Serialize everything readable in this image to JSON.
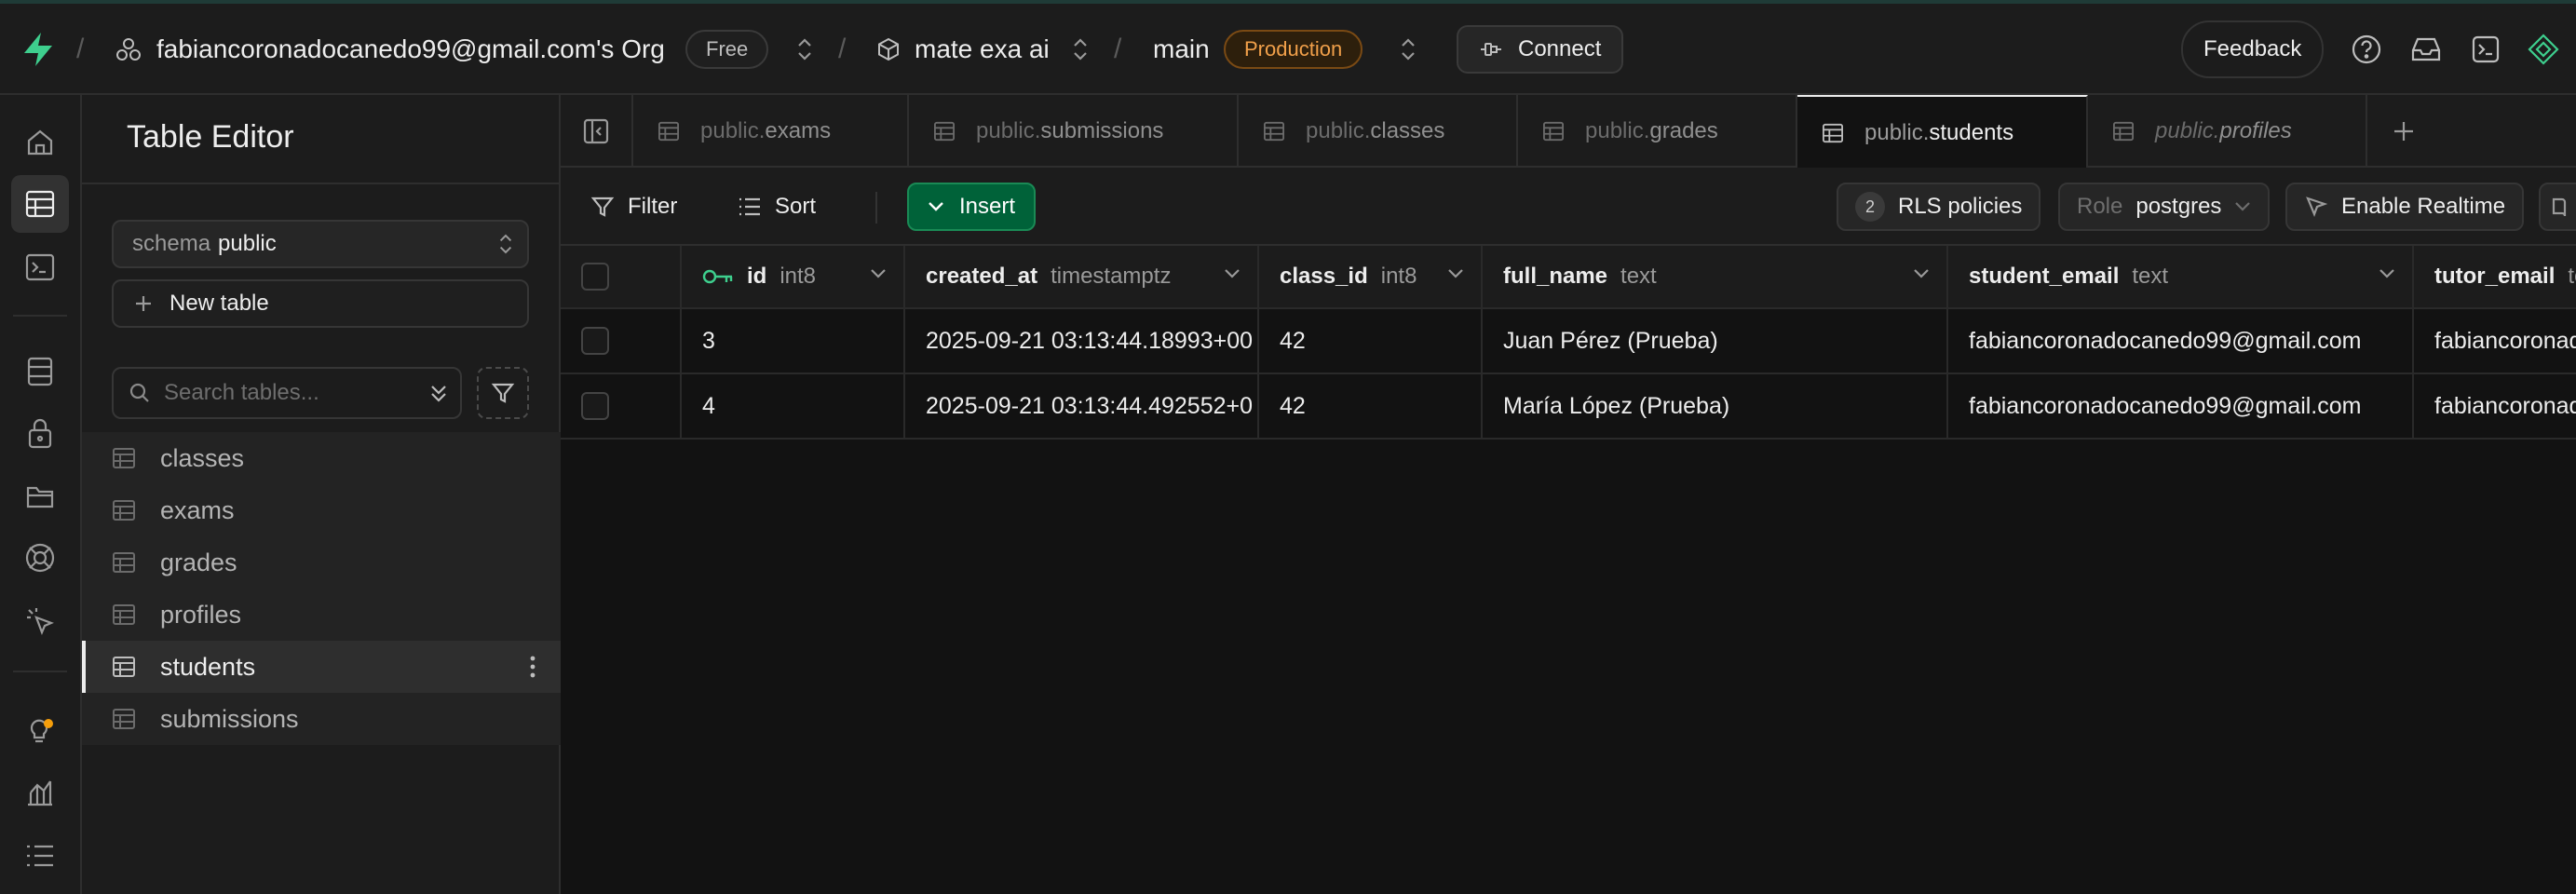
{
  "topbar": {
    "org_name": "fabiancoronadocanedo99@gmail.com's Org",
    "plan_badge": "Free",
    "project_name": "mate exa ai",
    "branch_name": "main",
    "env_badge": "Production",
    "connect_label": "Connect",
    "feedback_label": "Feedback",
    "separator": "/"
  },
  "sidebar": {
    "title": "Table Editor",
    "schema_label": "schema",
    "schema_value": "public",
    "new_table_label": "New table",
    "search_placeholder": "Search tables...",
    "tables": [
      "classes",
      "exams",
      "grades",
      "profiles",
      "students",
      "submissions"
    ],
    "active_table": "students"
  },
  "tabs": [
    {
      "schema": "public.",
      "name": "exams"
    },
    {
      "schema": "public.",
      "name": "submissions"
    },
    {
      "schema": "public.",
      "name": "classes"
    },
    {
      "schema": "public.",
      "name": "grades"
    },
    {
      "schema": "public.",
      "name": "students"
    },
    {
      "schema": "public.",
      "name": "profiles"
    }
  ],
  "toolbar": {
    "filter_label": "Filter",
    "sort_label": "Sort",
    "insert_label": "Insert",
    "rls_count": "2",
    "rls_label": "RLS policies",
    "role_label": "Role",
    "role_value": "postgres",
    "realtime_label": "Enable Realtime"
  },
  "grid": {
    "columns": [
      {
        "name": "id",
        "type": "int8"
      },
      {
        "name": "created_at",
        "type": "timestamptz"
      },
      {
        "name": "class_id",
        "type": "int8"
      },
      {
        "name": "full_name",
        "type": "text"
      },
      {
        "name": "student_email",
        "type": "text"
      },
      {
        "name": "tutor_email",
        "type": "te"
      }
    ],
    "rows": [
      [
        "3",
        "2025-09-21 03:13:44.18993+00",
        "42",
        "Juan Pérez (Prueba)",
        "fabiancoronadocanedo99@gmail.com",
        "fabiancoronad"
      ],
      [
        "4",
        "2025-09-21 03:13:44.492552+0",
        "42",
        "María López (Prueba)",
        "fabiancoronadocanedo99@gmail.com",
        "fabiancoronad"
      ]
    ]
  },
  "colors": {
    "brand_green": "#3ecf8e",
    "insert_green": "#006239",
    "production_orange": "#f1a04a",
    "notification_dot": "#f59e0b"
  },
  "icons": {
    "brand": "supabase-bolt-icon",
    "org": "org-icon",
    "project": "box-icon",
    "rail": [
      "home-icon",
      "table-editor-icon",
      "sql-editor-icon",
      "database-icon",
      "auth-lock-icon",
      "storage-folder-icon",
      "realtime-icon",
      "cursor-icon",
      "advisors-bulb-icon",
      "reports-chart-icon",
      "logs-list-icon"
    ]
  }
}
